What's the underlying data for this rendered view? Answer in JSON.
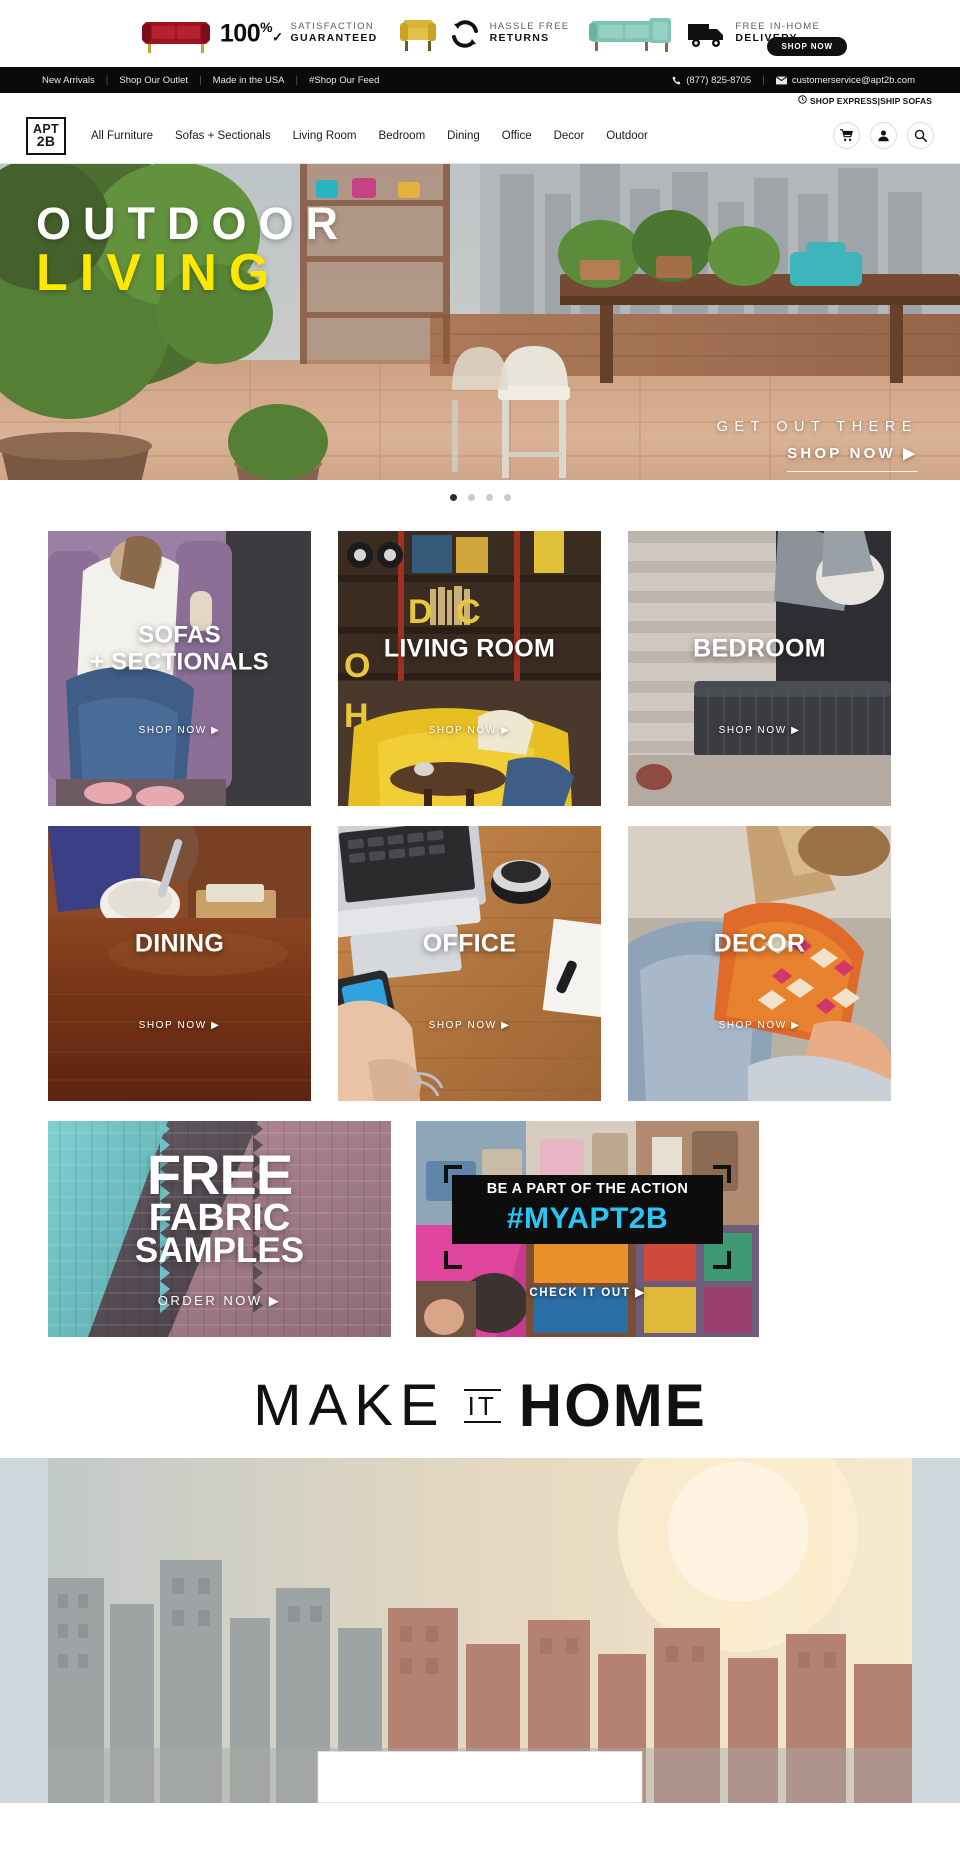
{
  "promo_strip": {
    "items": [
      {
        "icon": "red-sofa-icon",
        "line1": "SATISFACTION",
        "line2": "GUARANTEED",
        "badge": "100",
        "badge_sup": "%",
        "badge_check": "✓"
      },
      {
        "icon": "yellow-armchair-icon",
        "line1": "HASSLE FREE",
        "line2": "RETURNS"
      },
      {
        "icon": "teal-sectional-icon",
        "line1": "FREE IN-HOME",
        "line2": "DELIVERY"
      }
    ],
    "shop_now": "SHOP NOW"
  },
  "utility_bar": {
    "links": [
      "New Arrivals",
      "Shop Our Outlet",
      "Made in the USA",
      "#Shop Our Feed"
    ],
    "separator": "|",
    "phone": "(877) 825-8705",
    "email": "customerservice@apt2b.com"
  },
  "express_line": {
    "icon": "clock-icon",
    "text": "SHOP EXPRESS|SHIP SOFAS"
  },
  "nav": {
    "logo_line1": "APT",
    "logo_line2": "2B",
    "links": [
      "All Furniture",
      "Sofas + Sectionals",
      "Living Room",
      "Bedroom",
      "Dining",
      "Office",
      "Decor",
      "Outdoor"
    ],
    "actions": [
      {
        "name": "cart-icon"
      },
      {
        "name": "account-icon"
      },
      {
        "name": "search-icon"
      }
    ]
  },
  "hero": {
    "title_line1": "OUTDOOR",
    "title_line2": "LIVING",
    "cta_line1": "GET OUT THERE",
    "cta_line2": "SHOP NOW",
    "cta_arrow": "▶",
    "slides": 4,
    "active_slide": 1,
    "colors": {
      "title": "#ffffff",
      "accent": "#ffe800"
    }
  },
  "categories": {
    "shop_now": "SHOP NOW",
    "arrow": "▶",
    "row1": [
      {
        "label_line1": "SOFAS",
        "label_line2": "+ SECTIONALS",
        "image": "woman-on-purple-sofa"
      },
      {
        "label_line1": "LIVING ROOM",
        "label_line2": "",
        "image": "yellow-sofa-living-room"
      },
      {
        "label_line1": "BEDROOM",
        "label_line2": "",
        "image": "bedroom-grey-bed"
      }
    ],
    "row2": [
      {
        "label_line1": "DINING",
        "label_line2": "",
        "image": "dining-table-breakfast"
      },
      {
        "label_line1": "OFFICE",
        "label_line2": "",
        "image": "desk-laptop-mouse"
      },
      {
        "label_line1": "DECOR",
        "label_line2": "",
        "image": "orange-patterned-pillow"
      }
    ]
  },
  "promos": {
    "fabric": {
      "line1": "FREE",
      "line2": "FABRIC",
      "line3": "SAMPLES",
      "cta": "ORDER NOW",
      "arrow": "▶"
    },
    "social": {
      "headline": "BE A PART OF THE ACTION",
      "hashtag": "#MYAPT2B",
      "cta": "CHECK IT OUT",
      "arrow": "▶",
      "hashtag_color": "#29c6f5"
    }
  },
  "make_it_home": {
    "word1": "MAKE",
    "word2": "IT",
    "word3": "HOME"
  }
}
